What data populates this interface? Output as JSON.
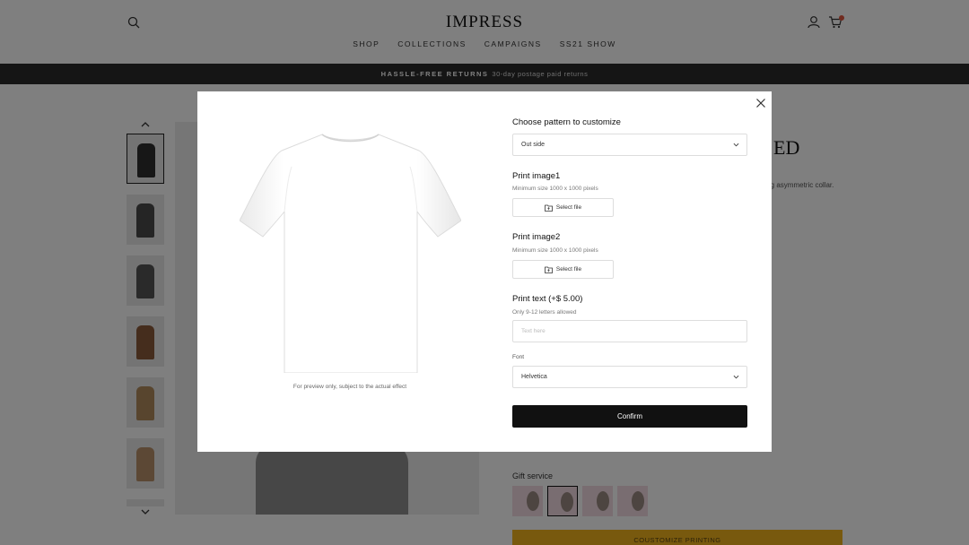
{
  "header": {
    "logo": "IMPRESS",
    "nav": [
      "SHOP",
      "COLLECTIONS",
      "CAMPAIGNS",
      "SS21 SHOW"
    ],
    "icons": [
      "search-icon",
      "account-icon",
      "cart-icon"
    ]
  },
  "announcement": {
    "bold": "HASSLE-FREE RETURNS",
    "text": "30-day postage paid returns"
  },
  "product": {
    "title_fragment": "ED",
    "description_fragment": "ning asymmetric collar.",
    "gift_label": "Gift service",
    "customize_label": "COUSTOMIZE PRINTING",
    "thumbnail_colors": [
      "#2f2f2f",
      "#4a4a4a",
      "#555555",
      "#8a5a3a",
      "#b08a5c",
      "#b8906a"
    ],
    "gift_selected_index": 1
  },
  "modal": {
    "preview_note": "For preview only, subject to the actual effect",
    "pattern": {
      "title": "Choose pattern to customize",
      "value": "Out side"
    },
    "image1": {
      "title": "Print image1",
      "hint": "Minimum size 1000 x 1000 pixels",
      "button": "Select file"
    },
    "image2": {
      "title": "Print image2",
      "hint": "Minimum size 1000 x 1000 pixels",
      "button": "Select file"
    },
    "text": {
      "title": "Print text (+$ 5.00)",
      "hint": "Only 9-12 letters allowed",
      "placeholder": "Text here"
    },
    "font": {
      "label": "Font",
      "value": "Helvetica"
    },
    "confirm": "Confirm"
  }
}
